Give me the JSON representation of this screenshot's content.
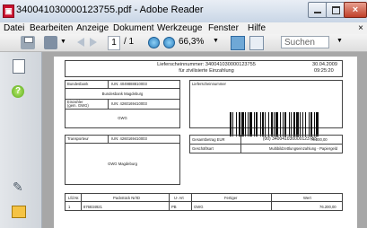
{
  "window": {
    "title": "340041030000123755.pdf - Adobe Reader",
    "app_icon": "adobe-reader-icon",
    "close_glyph": "×"
  },
  "menubar": {
    "items": [
      "Datei",
      "Bearbeiten",
      "Anzeige",
      "Dokument",
      "Werkzeuge",
      "Fenster",
      "Hilfe"
    ],
    "close": "×"
  },
  "toolbar": {
    "page_current": "1",
    "page_total": "/ 1",
    "zoom": "66,3%",
    "search_placeholder": "Suchen",
    "icons": [
      "print-icon",
      "navigate-icon",
      "previous-page-icon",
      "next-page-icon",
      "zoom-out-icon",
      "zoom-in-icon",
      "fit-page-icon",
      "fit-width-icon"
    ]
  },
  "navpane": {
    "icons": [
      "pages-icon",
      "help-icon",
      "attachments-icon",
      "comments-icon"
    ]
  },
  "document": {
    "header_title": "Lieferscheinnummer: 340041030000123755",
    "header_subtitle": "für zivilisierte Einzahlung",
    "header_date": "30.04.2009",
    "header_time": "09:25:20",
    "box1": {
      "label1": "Bundesbank",
      "value1": "IUN: 4049888810003",
      "line2": "Bundesbank Magdeburg",
      "label3": "Einzahler",
      "label3b": "(gem. GWG)",
      "value3": "IUN: 4260169410003",
      "line4": "GWG"
    },
    "box2": {
      "label": "Lieferscheinnummer",
      "barcode_text": "(00) 340041030000123755"
    },
    "box3": {
      "label": "Transporteur",
      "value": "IUN: 4260169410003",
      "line2": "GWG Magdeburg"
    },
    "box4": {
      "row1_label": "Gesamtbetrag EUR",
      "row1_value": "76.200,00",
      "row2_label": "Geschäftsart",
      "row2_value": "Multibildzettlungseinzahlung - Papiergeld"
    },
    "table": {
      "headers": [
        "Lfd.Nr.",
        "Packstück Nr/ID",
        "U- Art",
        "Fertiger",
        "Wert"
      ],
      "rows": [
        [
          "1",
          "876834921",
          "PB",
          "GWG",
          "76.200,00"
        ]
      ]
    }
  }
}
